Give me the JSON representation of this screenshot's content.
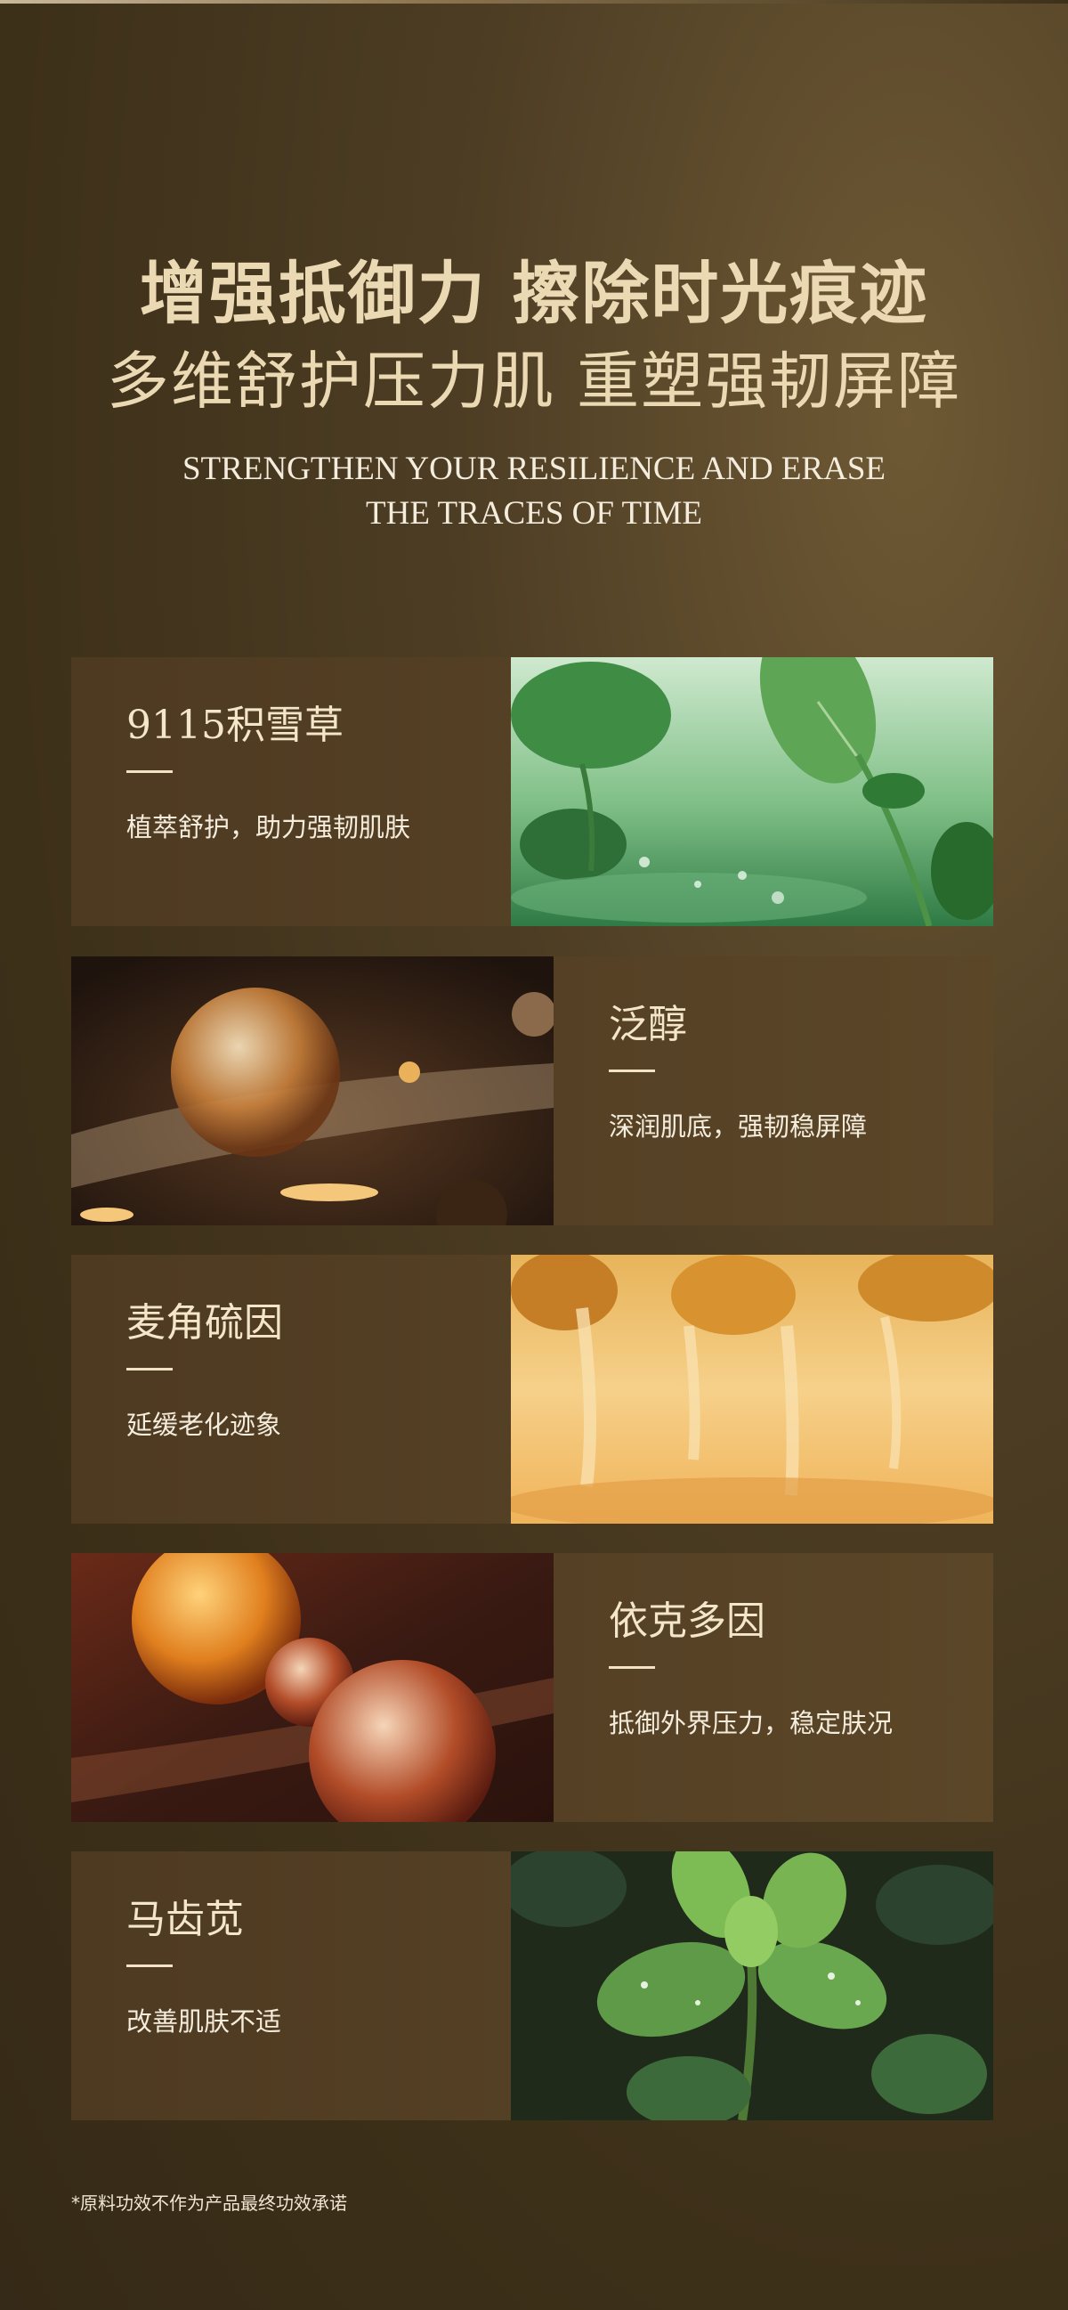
{
  "headline": {
    "line1": "增强抵御力 擦除时光痕迹",
    "line2": "多维舒护压力肌 重塑强韧屏障"
  },
  "subtitle": {
    "line1": "STRENGTHEN YOUR RESILIENCE AND ERASE",
    "line2": "THE TRACES OF TIME"
  },
  "ingredients": [
    {
      "name": "9115积雪草",
      "desc": "植萃舒护，助力强韧肌肤"
    },
    {
      "name": "泛醇",
      "desc": "深润肌底，强韧稳屏障"
    },
    {
      "name": "麦角硫因",
      "desc": "延缓老化迹象"
    },
    {
      "name": "依克多因",
      "desc": "抵御外界压力，稳定肤况"
    },
    {
      "name": "马齿苋",
      "desc": "改善肌肤不适"
    }
  ],
  "footnote": "*原料功效不作为产品最终功效承诺",
  "colors": {
    "accent_gold": "#ead9b3",
    "card_bg": "#4e3a21"
  }
}
